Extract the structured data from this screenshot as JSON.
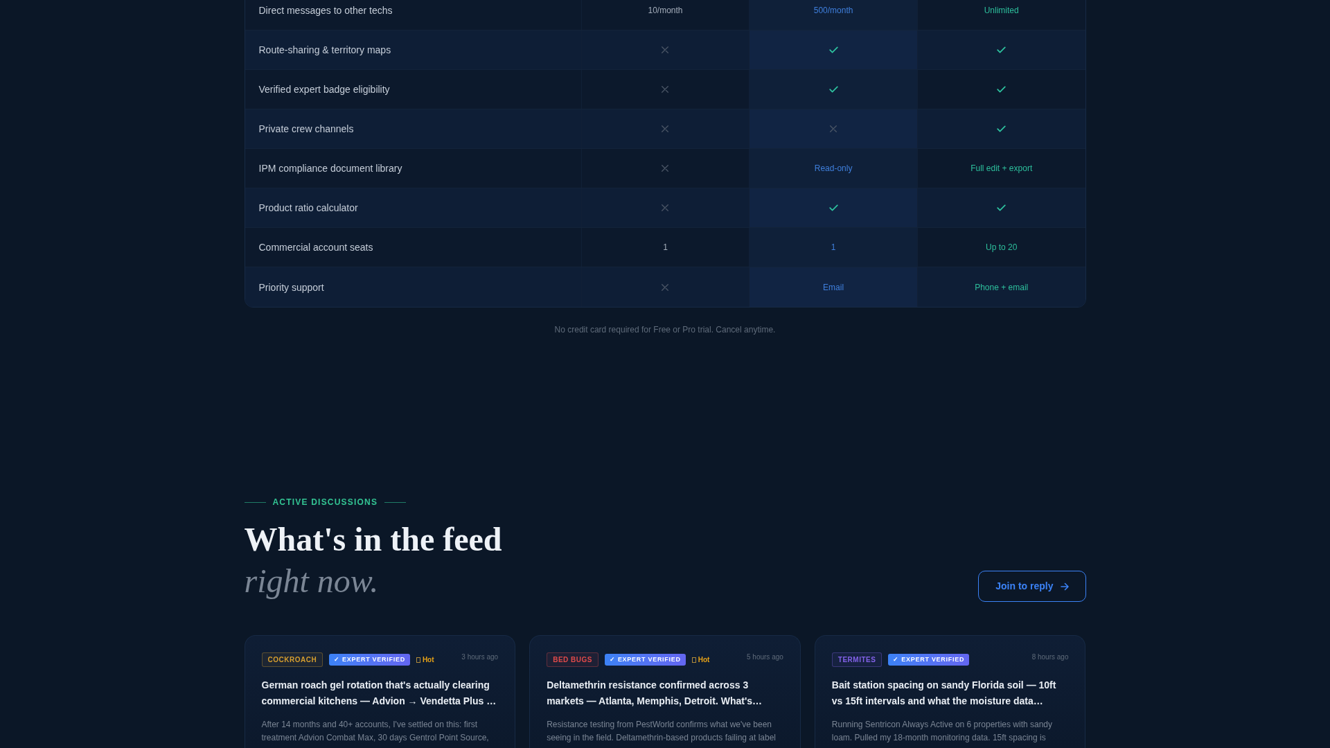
{
  "comparison_table": {
    "columns": [
      {
        "highlighted": false
      },
      {
        "highlighted": true
      },
      {
        "highlighted": false
      }
    ],
    "rows": [
      {
        "feature": "Direct messages to other techs",
        "cells": [
          {
            "kind": "text",
            "text": "10/month"
          },
          {
            "kind": "text",
            "text": "500/month"
          },
          {
            "kind": "text",
            "text": "Unlimited"
          }
        ]
      },
      {
        "feature": "Route-sharing & territory maps",
        "cells": [
          {
            "kind": "cross"
          },
          {
            "kind": "check"
          },
          {
            "kind": "check"
          }
        ]
      },
      {
        "feature": "Verified expert badge eligibility",
        "cells": [
          {
            "kind": "cross"
          },
          {
            "kind": "check"
          },
          {
            "kind": "check"
          }
        ]
      },
      {
        "feature": "Private crew channels",
        "cells": [
          {
            "kind": "cross"
          },
          {
            "kind": "cross"
          },
          {
            "kind": "check"
          }
        ]
      },
      {
        "feature": "IPM compliance document library",
        "cells": [
          {
            "kind": "cross"
          },
          {
            "kind": "text",
            "text": "Read-only"
          },
          {
            "kind": "text",
            "text": "Full edit + export"
          }
        ]
      },
      {
        "feature": "Product ratio calculator",
        "cells": [
          {
            "kind": "cross"
          },
          {
            "kind": "check"
          },
          {
            "kind": "check"
          }
        ]
      },
      {
        "feature": "Commercial account seats",
        "cells": [
          {
            "kind": "text",
            "text": "1"
          },
          {
            "kind": "text",
            "text": "1"
          },
          {
            "kind": "text",
            "text": "Up to 20"
          }
        ]
      },
      {
        "feature": "Priority support",
        "cells": [
          {
            "kind": "cross"
          },
          {
            "kind": "text",
            "text": "Email"
          },
          {
            "kind": "text",
            "text": "Phone + email"
          }
        ]
      }
    ],
    "note": "No credit card required for Free or Pro trial. Cancel anytime."
  },
  "discussions": {
    "eyebrow": "ACTIVE DISCUSSIONS",
    "heading": "What's in the feed",
    "heading_accent": "right now.",
    "button": {
      "label": "Join to reply"
    },
    "cards": [
      {
        "category": {
          "label": "COCKROACH",
          "color": "#d69e2e"
        },
        "verified": "✓ EXPERT VERIFIED",
        "flag": "Hot",
        "time": "3 hours ago",
        "title": "German roach gel rotation that's actually clearing commercial kitchens — Advion → Vendetta Plus …",
        "excerpt": "After 14 months and 40+ accounts, I've settled on this: first treatment Advion Combat Max, 30 days Gentrol Point Source,"
      },
      {
        "category": {
          "label": "BED BUGS",
          "color": "#e04a4a"
        },
        "verified": "✓ EXPERT VERIFIED",
        "flag": "Hot",
        "time": "5 hours ago",
        "title": "Deltamethrin resistance confirmed across 3 markets — Atlanta, Memphis, Detroit. What's…",
        "excerpt": "Resistance testing from PestWorld confirms what we've been seeing in the field. Deltamethrin-based products failing at label"
      },
      {
        "category": {
          "label": "TERMITES",
          "color": "#8462ea"
        },
        "verified": "✓ EXPERT VERIFIED",
        "time": "8 hours ago",
        "title": "Bait station spacing on sandy Florida soil — 10ft vs 15ft intervals and what the moisture data…",
        "excerpt": "Running Sentricon Always Active on 6 properties with sandy loam. Pulled my 18-month monitoring data. 15ft spacing is"
      }
    ]
  }
}
